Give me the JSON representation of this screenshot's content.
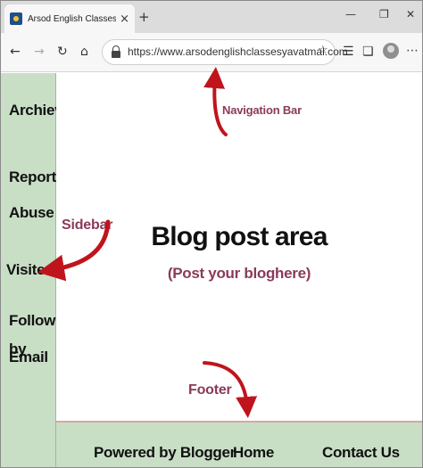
{
  "browser": {
    "tab_title": "Arsod English Classes, Yavatmal",
    "tab_close": "×",
    "new_tab": "+",
    "minimize": "—",
    "restore": "❐",
    "close": "✕",
    "url": "https://www.arsodenglishclassesyavatmal.com",
    "icons": [
      "back-arrow-icon",
      "forward-arrow-icon",
      "refresh-icon",
      "home-icon",
      "lock-icon",
      "favorite-star-icon",
      "favorites-icon",
      "collections-icon",
      "profile-avatar-icon",
      "more-icon"
    ]
  },
  "sidebar": {
    "items": [
      {
        "label": "Archieve"
      },
      {
        "label": "Report"
      },
      {
        "label": "Abuse"
      },
      {
        "label": "Visiters"
      },
      {
        "label": "Follow by"
      },
      {
        "label": "Email"
      }
    ]
  },
  "annotations": {
    "navigation_bar": "Navigation Bar",
    "sidebar": "Sidebar",
    "footer": "Footer"
  },
  "main": {
    "title": "Blog post area",
    "subtitle": "(Post your bloghere)"
  },
  "footer": {
    "items": [
      {
        "label": "Powered by Blogger"
      },
      {
        "label": "Home"
      },
      {
        "label": "Contact Us"
      }
    ]
  },
  "colors": {
    "panel": "#c8dfc6",
    "annotation": "#8a3a5a",
    "arrow": "#c0141c"
  }
}
